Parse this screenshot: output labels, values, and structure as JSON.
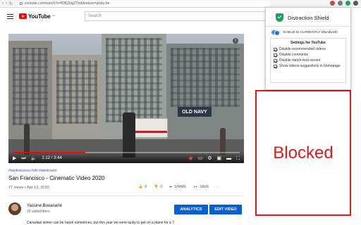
{
  "browser": {
    "url": "youtube.com/watch?v=83fQXkjZTto&feature=youtu.be",
    "nav_icons": [
      "back-icon",
      "forward-icon",
      "reload-icon"
    ]
  },
  "header": {
    "logo_text": "YouTube",
    "region": "CA",
    "search_placeholder": "Search"
  },
  "player": {
    "time": "1:12 / 3:44",
    "progress": 0.32,
    "street_sign": "OLD NAVY",
    "info_label": "i"
  },
  "video": {
    "tags": "#sanfrancisco #sfo #westcoast",
    "title": "San Francisco - Cinematic Video 2020",
    "meta": "77 views • Apr 13, 2020",
    "likes": "9",
    "dislikes": "0",
    "share_label": "SHARE",
    "save_label": "SAVE"
  },
  "channel": {
    "name": "Yassine Bouanane",
    "subscribers": "29 subscribers",
    "analytics_label": "ANALYTICS",
    "edit_label": "EDIT VIDEO",
    "description_peek": "Canadian winter can be harsh sometimes, but this year we were lucky to get on a plane for a 7"
  },
  "blocked": {
    "text": "Blocked",
    "color": "#e0191d"
  },
  "extension": {
    "title": "Distraction Shield",
    "status": "SHIELD IS CURRENTLY ENABLED",
    "enabled": true,
    "settings_title": "Settings for YouTube",
    "options": [
      {
        "label": "Disable recommended videos",
        "checked": true
      },
      {
        "label": "Disable comments",
        "checked": true
      },
      {
        "label": "Disable watch next screen",
        "checked": true
      },
      {
        "label": "Show videos suggestions in homepage",
        "checked": true
      }
    ],
    "accent": "#1aa260"
  }
}
